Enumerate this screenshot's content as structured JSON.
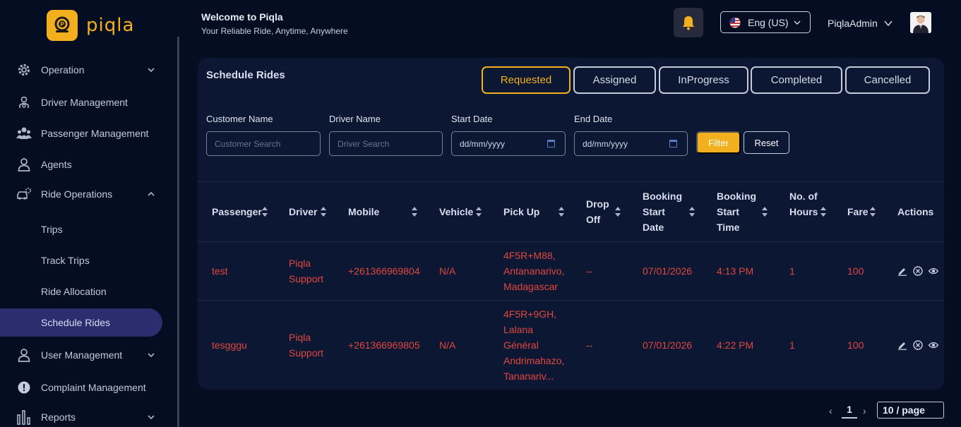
{
  "app": {
    "name": "piqla"
  },
  "header": {
    "welcome": "Welcome to Piqla",
    "tagline": "Your Reliable Ride, Anytime, Anywhere",
    "language": "Eng (US)",
    "username": "PiqlaAdmin"
  },
  "sidebar": {
    "items": [
      {
        "label": "Operation",
        "icon": "gear-icon"
      },
      {
        "label": "Driver Management",
        "icon": "driver-icon"
      },
      {
        "label": "Passenger Management",
        "icon": "users-icon"
      },
      {
        "label": "Agents",
        "icon": "person-icon"
      },
      {
        "label": "Ride Operations",
        "icon": "car-gear-icon"
      },
      {
        "label": "User Management",
        "icon": "person-icon"
      },
      {
        "label": "Complaint Management",
        "icon": "alert-icon"
      },
      {
        "label": "Reports",
        "icon": "bar-chart-icon"
      }
    ],
    "sub_items": [
      {
        "label": "Trips"
      },
      {
        "label": "Track Trips"
      },
      {
        "label": "Ride Allocation"
      },
      {
        "label": "Schedule Rides"
      }
    ]
  },
  "page": {
    "title": "Schedule Rides",
    "tabs": [
      {
        "label": "Requested",
        "active": true
      },
      {
        "label": "Assigned"
      },
      {
        "label": "InProgress"
      },
      {
        "label": "Completed"
      },
      {
        "label": "Cancelled"
      }
    ],
    "filters": {
      "customer_label": "Customer Name",
      "customer_placeholder": "Customer Search",
      "driver_label": "Driver Name",
      "driver_placeholder": "Driver Search",
      "start_label": "Start Date",
      "start_value": "dd/mm/yyyy",
      "end_label": "End Date",
      "end_value": "dd/mm/yyyy",
      "filter_button": "Filter",
      "reset_button": "Reset"
    },
    "table": {
      "headers": [
        "Passenger",
        "Driver",
        "Mobile",
        "Vehicle",
        "Pick Up",
        "Drop Off",
        "Booking Start Date",
        "Booking Start Time",
        "No. of Hours",
        "Fare",
        "Actions"
      ],
      "rows": [
        {
          "passenger": "test",
          "driver": "Piqla Support",
          "mobile": "+261366969804",
          "vehicle": "N/A",
          "pickup": "4F5R+M88, Antananarivo, Madagascar",
          "dropoff": "--",
          "date": "07/01/2026",
          "time": "4:13 PM",
          "hours": "1",
          "fare": "100"
        },
        {
          "passenger": "tesgggu",
          "driver": "Piqla Support",
          "mobile": "+261366969805",
          "vehicle": "N/A",
          "pickup": "4F5R+9GH, Lalana Général Andrimahazo, Tananariv...",
          "dropoff": "--",
          "date": "07/01/2026",
          "time": "4:22 PM",
          "hours": "1",
          "fare": "100"
        }
      ]
    },
    "pagination": {
      "current": "1",
      "page_size": "10 / page"
    }
  },
  "colors": {
    "accent": "#f2b01e",
    "danger": "#e0473e",
    "background": "#050d22",
    "card": "#0c1733"
  }
}
